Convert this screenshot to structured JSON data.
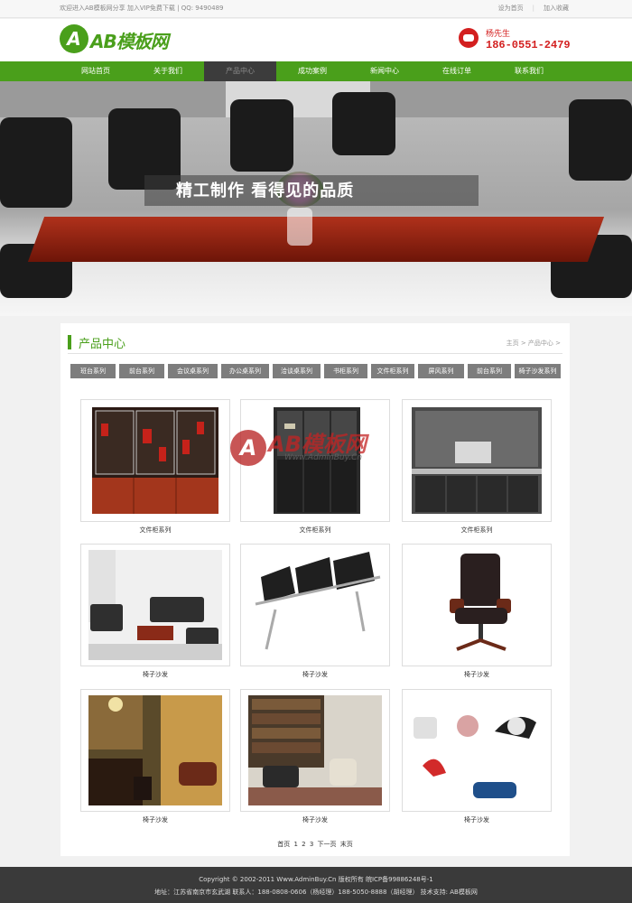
{
  "topbar": {
    "welcome": "欢迎进入AB模板网分享 加入VIP免费下载 | QQ: 9490489",
    "set_home": "设为首页",
    "add_favorite": "加入收藏"
  },
  "header": {
    "logo_mark": "A",
    "logo_text": "AB模板网",
    "contact_person": "杨先生",
    "contact_phone": "186-0551-2479"
  },
  "nav": {
    "items": [
      "网站首页",
      "关于我们",
      "产品中心",
      "成功案例",
      "新闻中心",
      "在线订单",
      "联系我们"
    ],
    "active_index": 2
  },
  "banner": {
    "slogan": "精工制作 看得见的品质"
  },
  "products_section": {
    "title": "产品中心",
    "breadcrumb": "主页 > 产品中心 >",
    "categories": [
      "班台系列",
      "前台系列",
      "会议桌系列",
      "办公桌系列",
      "洽谈桌系列",
      "书柜系列",
      "文件柜系列",
      "屏风系列",
      "前台系列",
      "椅子沙发系列"
    ],
    "items": [
      {
        "caption": "文件柜系列"
      },
      {
        "caption": "文件柜系列"
      },
      {
        "caption": "文件柜系列"
      },
      {
        "caption": "椅子沙发"
      },
      {
        "caption": "椅子沙发"
      },
      {
        "caption": "椅子沙发"
      },
      {
        "caption": "椅子沙发"
      },
      {
        "caption": "椅子沙发"
      },
      {
        "caption": "椅子沙发"
      }
    ],
    "pager": {
      "first": "首页",
      "pages": [
        "1",
        "2",
        "3"
      ],
      "next": "下一页",
      "last": "末页"
    }
  },
  "watermark": {
    "mark": "A",
    "name": "AB模板网",
    "url": "Www.AdminBuy.Cn"
  },
  "footer": {
    "line1": "Copyright © 2002-2011 Www.AdminBuy.Cn 版权所有    皖ICP备99886248号-1",
    "line2": "地址：江苏省南京市玄武湖    联系人：188-0808-0606（杨经理）188-5050-8888（胡经理） 技术支持: AB模板网"
  }
}
